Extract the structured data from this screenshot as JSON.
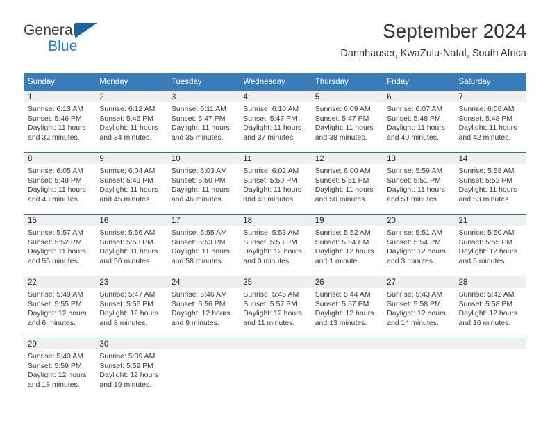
{
  "brand": {
    "line1": "General",
    "line2": "Blue",
    "accent_color": "#1c7fd0",
    "triangle_color": "#1565a8"
  },
  "header": {
    "title": "September 2024",
    "subtitle": "Dannhauser, KwaZulu-Natal, South Africa"
  },
  "theme": {
    "header_row_bg": "#3a7cba",
    "day_band_bg": "#efefef",
    "row_divider": "#2f6da8"
  },
  "weekday_headers": [
    "Sunday",
    "Monday",
    "Tuesday",
    "Wednesday",
    "Thursday",
    "Friday",
    "Saturday"
  ],
  "weeks": [
    [
      {
        "day": "1",
        "sunrise": "Sunrise: 6:13 AM",
        "sunset": "Sunset: 5:46 PM",
        "daylight1": "Daylight: 11 hours",
        "daylight2": "and 32 minutes."
      },
      {
        "day": "2",
        "sunrise": "Sunrise: 6:12 AM",
        "sunset": "Sunset: 5:46 PM",
        "daylight1": "Daylight: 11 hours",
        "daylight2": "and 34 minutes."
      },
      {
        "day": "3",
        "sunrise": "Sunrise: 6:11 AM",
        "sunset": "Sunset: 5:47 PM",
        "daylight1": "Daylight: 11 hours",
        "daylight2": "and 35 minutes."
      },
      {
        "day": "4",
        "sunrise": "Sunrise: 6:10 AM",
        "sunset": "Sunset: 5:47 PM",
        "daylight1": "Daylight: 11 hours",
        "daylight2": "and 37 minutes."
      },
      {
        "day": "5",
        "sunrise": "Sunrise: 6:09 AM",
        "sunset": "Sunset: 5:47 PM",
        "daylight1": "Daylight: 11 hours",
        "daylight2": "and 38 minutes."
      },
      {
        "day": "6",
        "sunrise": "Sunrise: 6:07 AM",
        "sunset": "Sunset: 5:48 PM",
        "daylight1": "Daylight: 11 hours",
        "daylight2": "and 40 minutes."
      },
      {
        "day": "7",
        "sunrise": "Sunrise: 6:06 AM",
        "sunset": "Sunset: 5:48 PM",
        "daylight1": "Daylight: 11 hours",
        "daylight2": "and 42 minutes."
      }
    ],
    [
      {
        "day": "8",
        "sunrise": "Sunrise: 6:05 AM",
        "sunset": "Sunset: 5:49 PM",
        "daylight1": "Daylight: 11 hours",
        "daylight2": "and 43 minutes."
      },
      {
        "day": "9",
        "sunrise": "Sunrise: 6:04 AM",
        "sunset": "Sunset: 5:49 PM",
        "daylight1": "Daylight: 11 hours",
        "daylight2": "and 45 minutes."
      },
      {
        "day": "10",
        "sunrise": "Sunrise: 6:03 AM",
        "sunset": "Sunset: 5:50 PM",
        "daylight1": "Daylight: 11 hours",
        "daylight2": "and 46 minutes."
      },
      {
        "day": "11",
        "sunrise": "Sunrise: 6:02 AM",
        "sunset": "Sunset: 5:50 PM",
        "daylight1": "Daylight: 11 hours",
        "daylight2": "and 48 minutes."
      },
      {
        "day": "12",
        "sunrise": "Sunrise: 6:00 AM",
        "sunset": "Sunset: 5:51 PM",
        "daylight1": "Daylight: 11 hours",
        "daylight2": "and 50 minutes."
      },
      {
        "day": "13",
        "sunrise": "Sunrise: 5:59 AM",
        "sunset": "Sunset: 5:51 PM",
        "daylight1": "Daylight: 11 hours",
        "daylight2": "and 51 minutes."
      },
      {
        "day": "14",
        "sunrise": "Sunrise: 5:58 AM",
        "sunset": "Sunset: 5:52 PM",
        "daylight1": "Daylight: 11 hours",
        "daylight2": "and 53 minutes."
      }
    ],
    [
      {
        "day": "15",
        "sunrise": "Sunrise: 5:57 AM",
        "sunset": "Sunset: 5:52 PM",
        "daylight1": "Daylight: 11 hours",
        "daylight2": "and 55 minutes."
      },
      {
        "day": "16",
        "sunrise": "Sunrise: 5:56 AM",
        "sunset": "Sunset: 5:53 PM",
        "daylight1": "Daylight: 11 hours",
        "daylight2": "and 56 minutes."
      },
      {
        "day": "17",
        "sunrise": "Sunrise: 5:55 AM",
        "sunset": "Sunset: 5:53 PM",
        "daylight1": "Daylight: 11 hours",
        "daylight2": "and 58 minutes."
      },
      {
        "day": "18",
        "sunrise": "Sunrise: 5:53 AM",
        "sunset": "Sunset: 5:53 PM",
        "daylight1": "Daylight: 12 hours",
        "daylight2": "and 0 minutes."
      },
      {
        "day": "19",
        "sunrise": "Sunrise: 5:52 AM",
        "sunset": "Sunset: 5:54 PM",
        "daylight1": "Daylight: 12 hours",
        "daylight2": "and 1 minute."
      },
      {
        "day": "20",
        "sunrise": "Sunrise: 5:51 AM",
        "sunset": "Sunset: 5:54 PM",
        "daylight1": "Daylight: 12 hours",
        "daylight2": "and 3 minutes."
      },
      {
        "day": "21",
        "sunrise": "Sunrise: 5:50 AM",
        "sunset": "Sunset: 5:55 PM",
        "daylight1": "Daylight: 12 hours",
        "daylight2": "and 5 minutes."
      }
    ],
    [
      {
        "day": "22",
        "sunrise": "Sunrise: 5:49 AM",
        "sunset": "Sunset: 5:55 PM",
        "daylight1": "Daylight: 12 hours",
        "daylight2": "and 6 minutes."
      },
      {
        "day": "23",
        "sunrise": "Sunrise: 5:47 AM",
        "sunset": "Sunset: 5:56 PM",
        "daylight1": "Daylight: 12 hours",
        "daylight2": "and 8 minutes."
      },
      {
        "day": "24",
        "sunrise": "Sunrise: 5:46 AM",
        "sunset": "Sunset: 5:56 PM",
        "daylight1": "Daylight: 12 hours",
        "daylight2": "and 9 minutes."
      },
      {
        "day": "25",
        "sunrise": "Sunrise: 5:45 AM",
        "sunset": "Sunset: 5:57 PM",
        "daylight1": "Daylight: 12 hours",
        "daylight2": "and 11 minutes."
      },
      {
        "day": "26",
        "sunrise": "Sunrise: 5:44 AM",
        "sunset": "Sunset: 5:57 PM",
        "daylight1": "Daylight: 12 hours",
        "daylight2": "and 13 minutes."
      },
      {
        "day": "27",
        "sunrise": "Sunrise: 5:43 AM",
        "sunset": "Sunset: 5:58 PM",
        "daylight1": "Daylight: 12 hours",
        "daylight2": "and 14 minutes."
      },
      {
        "day": "28",
        "sunrise": "Sunrise: 5:42 AM",
        "sunset": "Sunset: 5:58 PM",
        "daylight1": "Daylight: 12 hours",
        "daylight2": "and 16 minutes."
      }
    ],
    [
      {
        "day": "29",
        "sunrise": "Sunrise: 5:40 AM",
        "sunset": "Sunset: 5:59 PM",
        "daylight1": "Daylight: 12 hours",
        "daylight2": "and 18 minutes."
      },
      {
        "day": "30",
        "sunrise": "Sunrise: 5:39 AM",
        "sunset": "Sunset: 5:59 PM",
        "daylight1": "Daylight: 12 hours",
        "daylight2": "and 19 minutes."
      },
      {
        "day": "",
        "sunrise": "",
        "sunset": "",
        "daylight1": "",
        "daylight2": ""
      },
      {
        "day": "",
        "sunrise": "",
        "sunset": "",
        "daylight1": "",
        "daylight2": ""
      },
      {
        "day": "",
        "sunrise": "",
        "sunset": "",
        "daylight1": "",
        "daylight2": ""
      },
      {
        "day": "",
        "sunrise": "",
        "sunset": "",
        "daylight1": "",
        "daylight2": ""
      },
      {
        "day": "",
        "sunrise": "",
        "sunset": "",
        "daylight1": "",
        "daylight2": ""
      }
    ]
  ]
}
